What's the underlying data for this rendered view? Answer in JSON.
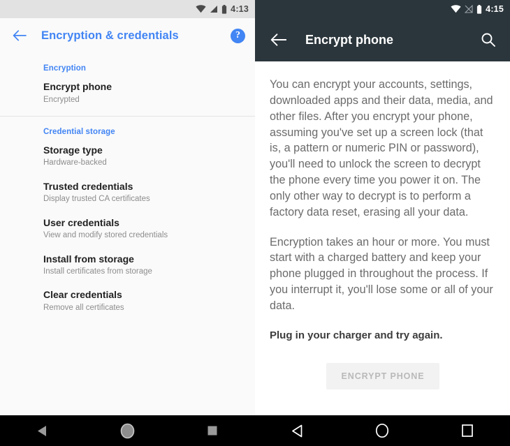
{
  "left_screen": {
    "status_bar": {
      "time": "4:13",
      "icons": [
        "wifi-icon",
        "cellular-signal-icon",
        "battery-icon"
      ],
      "background": "#e2e2e2",
      "foreground": "#4a4a4a"
    },
    "app_bar": {
      "back_icon": "arrow-back-icon",
      "title": "Encryption & credentials",
      "help_icon_label": "?",
      "accent_color": "#4285f4"
    },
    "sections": [
      {
        "header": "Encryption",
        "rows": [
          {
            "title": "Encrypt phone",
            "subtitle": "Encrypted"
          }
        ]
      },
      {
        "header": "Credential storage",
        "rows": [
          {
            "title": "Storage type",
            "subtitle": "Hardware-backed"
          },
          {
            "title": "Trusted credentials",
            "subtitle": "Display trusted CA certificates"
          },
          {
            "title": "User credentials",
            "subtitle": "View and modify stored credentials"
          },
          {
            "title": "Install from storage",
            "subtitle": "Install certificates from storage"
          },
          {
            "title": "Clear credentials",
            "subtitle": "Remove all certificates"
          }
        ]
      }
    ],
    "nav_bar": {
      "style": "filled-gray",
      "back_icon": "nav-back-triangle-icon",
      "home_icon": "nav-home-circle-icon",
      "recents_icon": "nav-recents-square-icon"
    }
  },
  "right_screen": {
    "status_bar": {
      "time": "4:15",
      "icons": [
        "wifi-icon",
        "no-sim-signal-icon",
        "battery-icon"
      ],
      "background": "#2b363c",
      "foreground": "#ffffff"
    },
    "app_bar": {
      "back_icon": "arrow-back-icon",
      "title": "Encrypt phone",
      "search_icon": "search-icon",
      "background": "#2b363c"
    },
    "body": {
      "paragraph_1": "You can encrypt your accounts, settings, downloaded apps and their data, media, and other files. After you encrypt your phone, assuming you've set up a screen lock (that is, a pattern or numeric PIN or password), you'll need to unlock the screen to decrypt the phone every time you power it on. The only other way to decrypt is to perform a factory data reset, erasing all your data.",
      "paragraph_2": "Encryption takes an hour or more. You must start with a charged battery and keep your phone plugged in throughout the process. If you interrupt it, you'll lose some or all of your data.",
      "warning": "Plug in your charger and try again.",
      "button_label": "ENCRYPT PHONE",
      "button_state": "disabled"
    },
    "nav_bar": {
      "style": "outlined-white",
      "back_icon": "nav-back-triangle-icon",
      "home_icon": "nav-home-circle-icon",
      "recents_icon": "nav-recents-square-icon"
    }
  }
}
